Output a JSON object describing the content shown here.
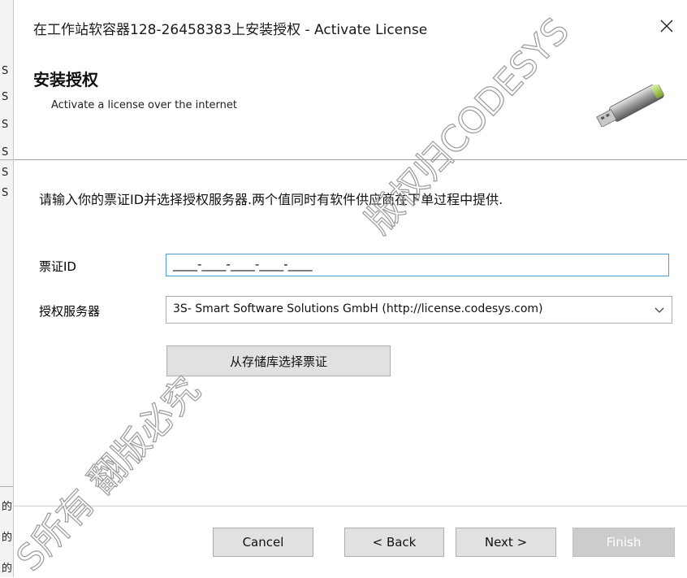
{
  "window": {
    "title": "在工作站软容器128-26458383上安装授权 - Activate License",
    "close_glyph": "×"
  },
  "header": {
    "title": "安装授权",
    "subtitle": "Activate a license over the internet",
    "icon": "usb-dongle-icon"
  },
  "body": {
    "instruction": "请输入你的票证ID并选择授权服务器.两个值同时有软件供应商在下单过程中提供.",
    "ticket_label": "票证ID",
    "ticket_value": "____-____-____-____-____",
    "server_label": "授权服务器",
    "server_value": "3S- Smart Software Solutions GmbH (http://license.codesys.com)",
    "store_button": "从存储库选择票证"
  },
  "footer": {
    "cancel": "Cancel",
    "back": "< Back",
    "next": "Next >",
    "finish": "Finish"
  },
  "background_window": {
    "letters": [
      "S",
      "S",
      "S",
      "S",
      "S",
      "S"
    ],
    "bottom_chars": [
      "的",
      "的",
      "的"
    ]
  },
  "watermark": {
    "line1": "版权归CODESYS所有 翻版必究",
    "upper": "版权归CODESYS",
    "lower": "S所有 翻版必究"
  },
  "colors": {
    "accent_focus": "#4a9ad8",
    "button_face": "#e1e1e1",
    "disabled_button": "#cccccc"
  }
}
